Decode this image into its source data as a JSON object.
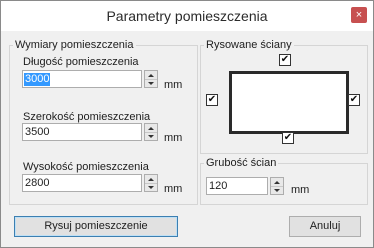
{
  "window": {
    "title": "Parametry pomieszczenia",
    "close_glyph": "×"
  },
  "dimensions": {
    "group_label": "Wymiary pomieszczenia",
    "length": {
      "label": "Długość pomieszczenia",
      "value": "3000",
      "unit": "mm"
    },
    "width": {
      "label": "Szerokość pomieszczenia",
      "value": "3500",
      "unit": "mm"
    },
    "height": {
      "label": "Wysokość pomieszczenia",
      "value": "2800",
      "unit": "mm"
    }
  },
  "walls": {
    "group_label": "Rysowane ściany",
    "top_checked": true,
    "left_checked": true,
    "right_checked": true,
    "bottom_checked": true,
    "check_glyph": "✔"
  },
  "thickness": {
    "group_label": "Grubość ścian",
    "value": "120",
    "unit": "mm"
  },
  "buttons": {
    "draw": "Rysuj pomieszczenie",
    "cancel": "Anuluj"
  },
  "colors": {
    "close_button": "#c75050",
    "selection": "#3399ff",
    "default_button_border": "#3c7fb1"
  }
}
